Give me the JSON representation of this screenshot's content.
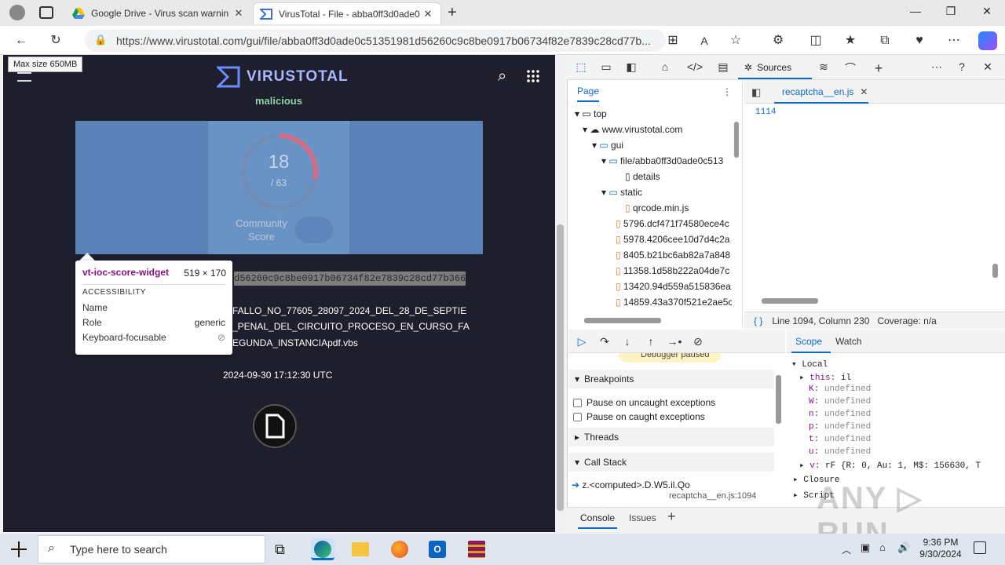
{
  "browser": {
    "tabs": [
      {
        "label": "Google Drive - Virus scan warnin",
        "active": false
      },
      {
        "label": "VirusTotal - File - abba0ff3d0ade0",
        "active": true
      }
    ],
    "url": "https://www.virustotal.com/gui/file/abba0ff3d0ade0c51351981d56260c9c8be0917b06734f82e7839c28cd77b...",
    "tooltip": "Max size 650MB"
  },
  "vt": {
    "logo": "VIRUSTOTAL",
    "verdict": "malicious",
    "score": "18",
    "total": "/ 63",
    "community": "Community Score",
    "hash": "d56260c9c8be0917b06734f82e7839c28cd77b366",
    "filename": [
      "FALLO_NO_77605_28097_2024_DEL_28_DE_SEPTIE",
      "_PENAL_DEL_CIRCUITO_PROCESO_EN_CURSO_FA",
      "EGUNDA_INSTANCIApdf.vbs"
    ],
    "date": "2024-09-30 17:12:30 UTC"
  },
  "inspector": {
    "element": "vt-ioc-score-widget",
    "size": "519 × 170",
    "section": "ACCESSIBILITY",
    "rows": [
      {
        "k": "Name",
        "v": ""
      },
      {
        "k": "Role",
        "v": "generic"
      },
      {
        "k": "Keyboard-focusable",
        "v": ""
      }
    ]
  },
  "devtools": {
    "sources_tab": "Sources",
    "page_tab": "Page",
    "tree": [
      "top",
      "www.virustotal.com",
      "gui",
      "file/abba0ff3d0ade0c513",
      "details",
      "static",
      "qrcode.min.js",
      "5796.dcf471f74580ece4c",
      "5978.4206cee10d7d4c2a",
      "8405.b21bc6ab82a7a848",
      "11358.1d58b222a04de7c",
      "13420.94d559a515836ea:",
      "14859.43a370f521e2ae5c"
    ],
    "editor_tab": "recaptcha__en.js",
    "line_number": "1114",
    "status": "Line 1094, Column 230",
    "coverage": "Coverage: n/a",
    "paused": "Debugger paused",
    "breakpoints": "Breakpoints",
    "pause_uncaught": "Pause on uncaught exceptions",
    "pause_caught": "Pause on caught exceptions",
    "threads": "Threads",
    "callstack": "Call Stack",
    "frame": "z.<computed>.D.W5.il.Qo",
    "frame_loc": "recaptcha__en.js:1094",
    "scope_tab": "Scope",
    "watch_tab": "Watch",
    "local": "Local",
    "scope_vars": [
      {
        "k": "this:",
        "v": "il"
      },
      {
        "k": "K:",
        "v": "undefined"
      },
      {
        "k": "W:",
        "v": "undefined"
      },
      {
        "k": "n:",
        "v": "undefined"
      },
      {
        "k": "p:",
        "v": "undefined"
      },
      {
        "k": "t:",
        "v": "undefined"
      },
      {
        "k": "u:",
        "v": "undefined"
      },
      {
        "k": "v:",
        "v": "rF {R: 0, Au: 1, M$: 156630, T"
      }
    ],
    "closure": "Closure",
    "script": "Script",
    "console": "Console",
    "issues": "Issues"
  },
  "taskbar": {
    "search": "Type here to search",
    "time": "9:36 PM",
    "date": "9/30/2024"
  }
}
